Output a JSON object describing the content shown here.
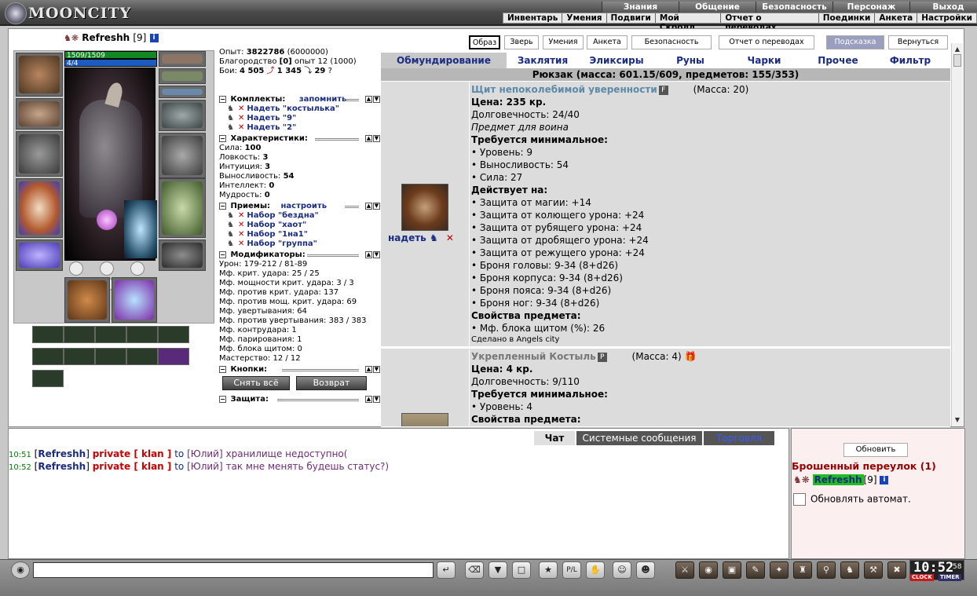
{
  "logo": {
    "name": "MOONCITY"
  },
  "topnav_primary": [
    "Знания",
    "Общение",
    "Безопасность",
    "Персонаж",
    "Выход"
  ],
  "topnav_secondary": [
    "Инвентарь",
    "Умения",
    "Подвиги",
    "Мой Скролл",
    "Отчет о переводах",
    "Поединки",
    "Анкета",
    "Настройки"
  ],
  "character": {
    "name": "Refreshh",
    "level": "[9]",
    "hp": "1509/1509",
    "mp": "4/4",
    "hp_fraction": 1.0,
    "mp_fraction": 1.0
  },
  "stats": {
    "exp_label": "Опыт:",
    "exp_value": "3822786",
    "exp_next": "(6000000)",
    "nobility_label": "Благородство",
    "nobility_value": "[0]",
    "nobility_exp": "опыт 12 (1000)",
    "battles_label": "Бои:",
    "battles_won": "4 505",
    "battles_lost": "1 345",
    "battles_draw": "29",
    "sets_title": "Комплекты:",
    "sets_action": "запомнить",
    "sets": [
      "Надеть \"костылька\"",
      "Надеть \"9\"",
      "Надеть \"2\""
    ],
    "chars_title": "Характеристики:",
    "chars": [
      {
        "label": "Сила:",
        "value": "100"
      },
      {
        "label": "Ловкость:",
        "value": "3"
      },
      {
        "label": "Интуиция:",
        "value": "3"
      },
      {
        "label": "Выносливость:",
        "value": "54"
      },
      {
        "label": "Интеллект:",
        "value": "0"
      },
      {
        "label": "Мудрость:",
        "value": "0"
      }
    ],
    "tricks_title": "Приемы:",
    "tricks_action": "настроить",
    "tricks": [
      "Набор \"бездна\"",
      "Набор \"хаот\"",
      "Набор \"1на1\"",
      "Набор \"группа\""
    ],
    "mods_title": "Модификаторы:",
    "mods": [
      "Урон: 179-212 / 81-89",
      "Мф. крит. удара: 25 / 25",
      "Мф. мощности крит. удара: 3 / 3",
      "Мф. против крит. удара: 137",
      "Мф. против мощ. крит. удара: 69",
      "Мф. увертывания: 64",
      "Мф. против увертывания: 383 / 383",
      "Мф. контрудара: 1",
      "Мф. парирования: 1",
      "Мф. блока щитом: 0",
      "Мастерство: 12 / 12"
    ],
    "buttons_title": "Кнопки:",
    "btn_remove_all": "Снять всё",
    "btn_return": "Возврат",
    "defense_title": "Защита:"
  },
  "tab_buttons": [
    "Образ",
    "Зверь",
    "Умения",
    "Анкета",
    "Безопасность",
    "Отчет о переводах",
    "Подсказка",
    "Вернуться"
  ],
  "categories": [
    "Обмундирование",
    "Заклятия",
    "Эликсиры",
    "Руны",
    "Чарки",
    "Прочее",
    "Фильтр"
  ],
  "backpack": "Рюкзак (масса: 601.15/609, предметов: 155/353)",
  "items": [
    {
      "name": "Щит непоколебимой уверенности",
      "flag": "F",
      "mass": "(Масса: 20)",
      "price": "Цена: 235 кр.",
      "durability": "Долговечность: 24/40",
      "note": "Предмет для воина",
      "req_title": "Требуется минимальное:",
      "reqs": [
        "• Уровень: 9",
        "• Выносливость: 54",
        "• Сила: 27"
      ],
      "effects_title": "Действует на:",
      "effects": [
        "• Защита от магии: +14",
        "• Защита от колющего урона: +24",
        "• Защита от рубящего урона: +24",
        "• Защита от дробящего урона: +24",
        "• Защита от режущего урона: +24",
        "• Броня головы: 9-34 (8+d26)",
        "• Броня корпуса: 9-34 (8+d26)",
        "• Броня пояса: 9-34 (8+d26)",
        "• Броня ног: 9-34 (8+d26)"
      ],
      "props_title": "Свойства предмета:",
      "props": [
        "• Мф. блока щитом (%): 26"
      ],
      "made": "Сделано в Angels city",
      "wear": "надеть"
    },
    {
      "name": "Укрепленный Костыль",
      "flag": "P",
      "mass": "(Масса: 4)",
      "price": "Цена: 4 кр.",
      "durability": "Долговечность: 9/110",
      "req_title": "Требуется минимальное:",
      "reqs": [
        "• Уровень: 4"
      ],
      "props_title": "Свойства предмета:"
    }
  ],
  "chat": {
    "tabs": [
      "Чат",
      "Системные сообщения",
      "Торговля"
    ],
    "messages": [
      {
        "time": "10:51",
        "nick": "Refreshh",
        "priv": "private [ klan ]",
        "to": "to",
        "target": "[Юлий]",
        "text": "хранилище недоступно("
      },
      {
        "time": "10:52",
        "nick": "Refreshh",
        "priv": "private [ klan ]",
        "to": "to",
        "target": "[Юлий]",
        "text": "так мне менять будешь статус?)"
      }
    ]
  },
  "right": {
    "refresh": "Обновить",
    "location": "Брошенный переулок (1)",
    "player": "Refreshh",
    "player_level": "[9]",
    "auto": "Обновлять автомат."
  },
  "clock": {
    "time": "10:52",
    "seconds": "58",
    "clock_label": "CLOCK",
    "timer_label": "TIMER"
  },
  "bottom_icons": [
    "enter-icon",
    "eraser-icon",
    "filter-icon",
    "screen-icon",
    "dance-icon",
    "pl-icon",
    "hand-icon",
    "smile-icon",
    "emote-icon"
  ],
  "action_icons": [
    "attack-icon",
    "bag-icon",
    "chest-icon",
    "scroll-icon",
    "skill-icon",
    "armor-icon",
    "lock-icon",
    "group-icon",
    "hammer-icon",
    "flag-icon",
    "exit-icon"
  ]
}
